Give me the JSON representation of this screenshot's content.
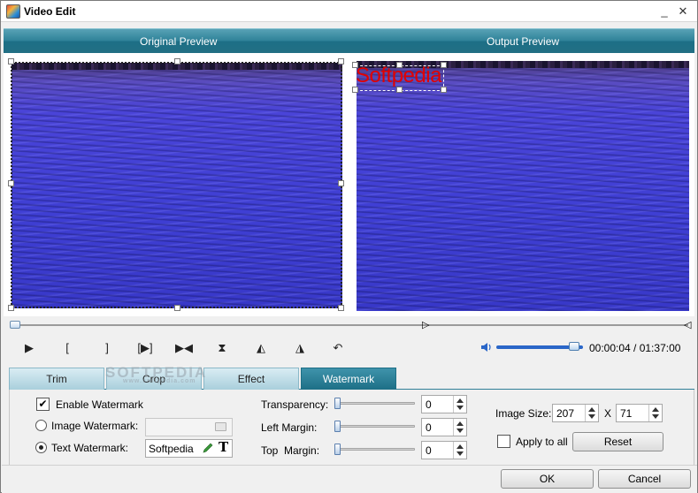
{
  "window": {
    "title": "Video Edit",
    "minimize_glyph": "_",
    "close_glyph": "✕"
  },
  "preview": {
    "original_label": "Original Preview",
    "output_label": "Output Preview"
  },
  "watermark_overlay": {
    "text": "Softpedia",
    "color": "#e10000"
  },
  "playback": {
    "buttons": [
      {
        "name": "play-icon",
        "glyph": "▶"
      },
      {
        "name": "mark-in-icon",
        "glyph": "["
      },
      {
        "name": "mark-out-icon",
        "glyph": "]"
      },
      {
        "name": "play-selection-icon",
        "glyph": "[▶]"
      },
      {
        "name": "next-frame-icon",
        "glyph": "▶◀"
      },
      {
        "name": "flip-vertical-icon",
        "glyph": "⧗"
      },
      {
        "name": "rotate-left-icon",
        "glyph": "◭"
      },
      {
        "name": "rotate-right-icon",
        "glyph": "◮"
      },
      {
        "name": "undo-icon",
        "glyph": "↶"
      }
    ],
    "time": "00:00:04 / 01:37:00",
    "volume_level": 0.9
  },
  "tabs": [
    {
      "label": "Trim",
      "active": false
    },
    {
      "label": "Crop",
      "active": false
    },
    {
      "label": "Effect",
      "active": false
    },
    {
      "label": "Watermark",
      "active": true
    }
  ],
  "site_watermark": {
    "main": "SOFTPEDIA",
    "sub": "www.softpedia.com"
  },
  "watermark_panel": {
    "enable_label": "Enable Watermark",
    "enable_checked": true,
    "image_label": "Image Watermark:",
    "image_value": "",
    "text_label": "Text Watermark:",
    "text_value": "Softpedia",
    "text_selected": true,
    "transparency_label": "Transparency:",
    "transparency_value": "0",
    "left_margin_label": "Left Margin:",
    "left_margin_value": "0",
    "top_margin_label": "Top  Margin:",
    "top_margin_value": "0",
    "image_size_label": "Image Size:",
    "width_value": "207",
    "x_label": "X",
    "height_value": "71",
    "apply_all_label": "Apply to all",
    "apply_all_checked": false,
    "reset_label": "Reset"
  },
  "footer": {
    "ok_label": "OK",
    "cancel_label": "Cancel"
  },
  "colors": {
    "header_teal": "#2f8299",
    "tab_active": "#1d6f86",
    "watermark_red": "#e10000"
  }
}
